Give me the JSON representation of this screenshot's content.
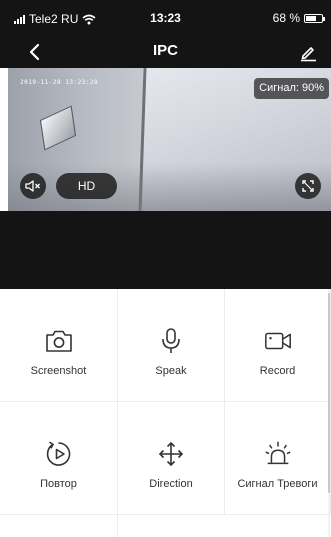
{
  "status_bar": {
    "carrier": "Tele2 RU",
    "time": "13:23",
    "battery": "68 %",
    "battery_level": 0.68,
    "icons": [
      "signal-bars-icon",
      "wifi-icon",
      "battery-icon"
    ]
  },
  "nav": {
    "title": "IPC",
    "icons": [
      "back-chevron-icon",
      "edit-pencil-icon"
    ]
  },
  "video": {
    "timestamp": "2019-11-28 13:23:28",
    "signal": "Сигнал: 90%",
    "quality": "HD",
    "icons": [
      "mute-speaker-icon",
      "fullscreen-icon"
    ]
  },
  "controls": [
    {
      "label": "Screenshot",
      "icon": "camera-icon"
    },
    {
      "label": "Speak",
      "icon": "microphone-icon"
    },
    {
      "label": "Record",
      "icon": "video-camera-icon"
    },
    {
      "label": "Повтор",
      "icon": "playback-icon"
    },
    {
      "label": "Direction",
      "icon": "direction-arrows-icon"
    },
    {
      "label": "Сигнал Тревоги",
      "icon": "alarm-light-icon"
    }
  ],
  "colors": {
    "header_bg": "#141414",
    "grid_line": "#ececec",
    "icon_stroke": "#333333"
  }
}
